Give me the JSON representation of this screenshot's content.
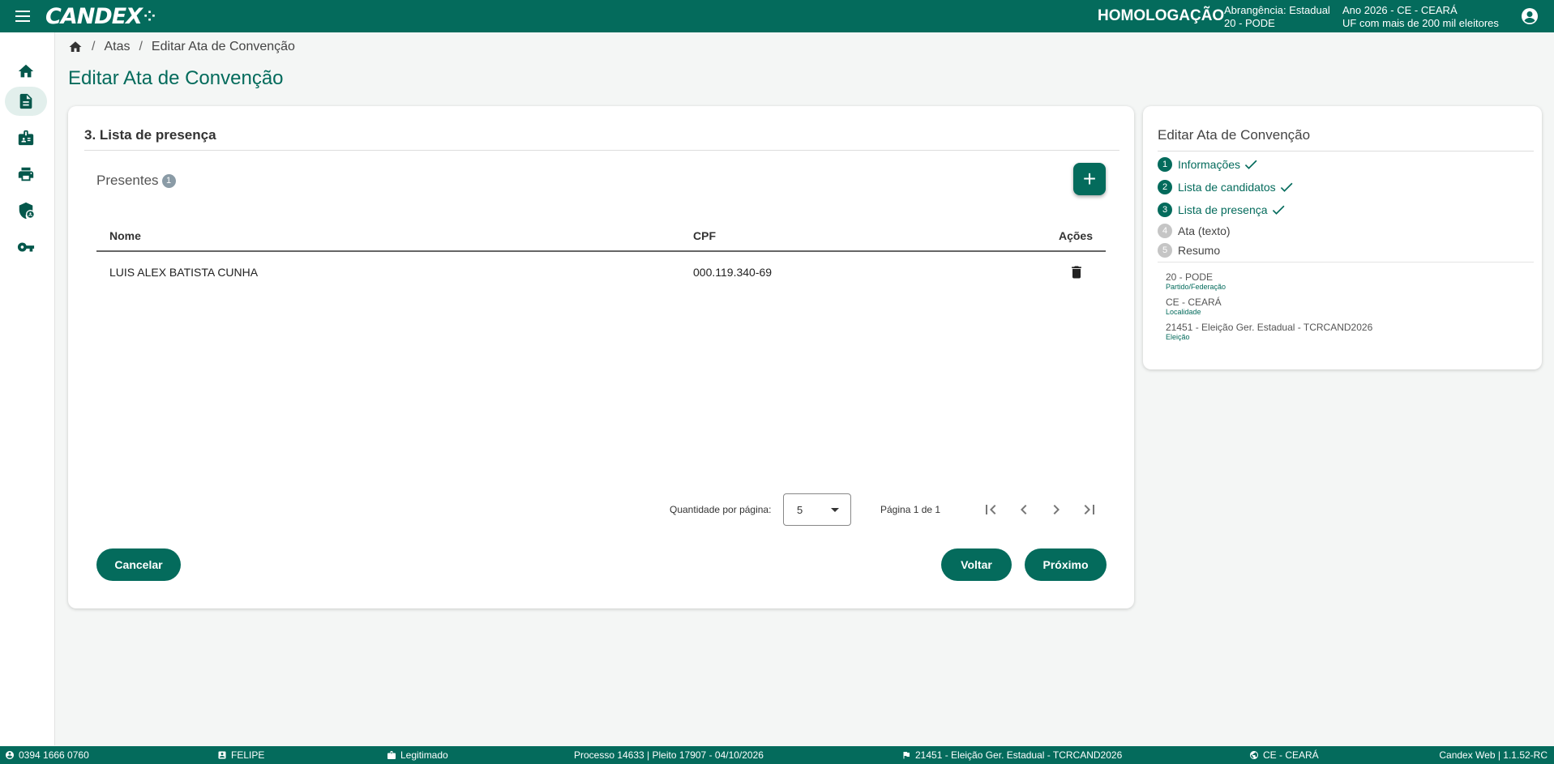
{
  "header": {
    "logo": "CANDEX",
    "environment": "HOMOLOGAÇÃO",
    "context_line1_left": "Abrangência: Estadual",
    "context_line2_left": "20 - PODE",
    "context_line1_right": "Ano 2026 - CE - CEARÁ",
    "context_line2_right": "UF com mais de 200 mil eleitores"
  },
  "sidebar": {
    "items": [
      {
        "icon": "home-icon"
      },
      {
        "icon": "document-icon",
        "active": true
      },
      {
        "icon": "badge-icon"
      },
      {
        "icon": "printer-icon"
      },
      {
        "icon": "shield-user-icon"
      },
      {
        "icon": "key-icon"
      }
    ]
  },
  "breadcrumb": {
    "items": [
      "Atas",
      "Editar Ata de Convenção"
    ]
  },
  "page": {
    "title": "Editar Ata de Convenção"
  },
  "main": {
    "section_title": "3. Lista de presença",
    "list_title": "Presentes",
    "count": "1",
    "add_label": "+",
    "table": {
      "columns": [
        "Nome",
        "CPF",
        "Ações"
      ],
      "rows": [
        {
          "nome": "LUIS ALEX BATISTA CUNHA",
          "cpf": "000.119.340-69"
        }
      ]
    },
    "paginator": {
      "items_per_page_label": "Quantidade por página:",
      "items_per_page_value": "5",
      "range_label": "Página 1 de 1"
    },
    "buttons": {
      "cancel": "Cancelar",
      "back": "Voltar",
      "next": "Próximo"
    }
  },
  "panel": {
    "title": "Editar Ata de Convenção",
    "steps": [
      {
        "num": "1",
        "label": "Informações",
        "done": true
      },
      {
        "num": "2",
        "label": "Lista de candidatos",
        "done": true
      },
      {
        "num": "3",
        "label": "Lista de presença",
        "done": true
      },
      {
        "num": "4",
        "label": "Ata (texto)",
        "done": false
      },
      {
        "num": "5",
        "label": "Resumo",
        "done": false
      }
    ],
    "info": [
      {
        "value": "20 - PODE",
        "key": "Partido/Federação"
      },
      {
        "value": "CE - CEARÁ",
        "key": "Localidade"
      },
      {
        "value": "21451 - Eleição Ger. Estadual - TCRCAND2026",
        "key": "Eleição"
      }
    ]
  },
  "footer": {
    "phone": "0394 1666 0760",
    "user": "FELIPE",
    "status": "Legitimado",
    "process": "Processo 14633 | Pleito 17907 - 04/10/2026",
    "election": "21451 - Eleição Ger. Estadual - TCRCAND2026",
    "location": "CE - CEARÁ",
    "version": "Candex Web | 1.1.52-RC"
  },
  "colors": {
    "primary": "#046b5c",
    "background": "#f4f6f5"
  }
}
